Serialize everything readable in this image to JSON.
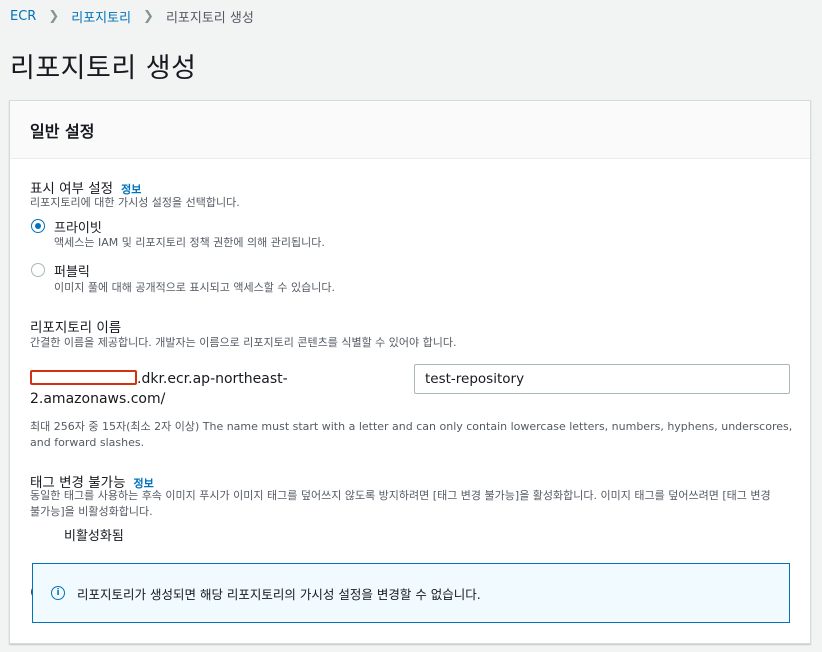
{
  "breadcrumb": {
    "items": [
      "ECR",
      "리포지토리"
    ],
    "current": "리포지토리 생성"
  },
  "page_title": "리포지토리 생성",
  "general": {
    "title": "일반 설정",
    "visibility": {
      "label": "표시 여부 설정",
      "info": "정보",
      "description": "리포지토리에 대한 가시성 설정을 선택합니다.",
      "options": [
        {
          "label": "프라이빗",
          "description": "액세스는 IAM 및 리포지토리 정책 권한에 의해 관리됩니다.",
          "selected": true
        },
        {
          "label": "퍼블릭",
          "description": "이미지 풀에 대해 공개적으로 표시되고 액세스할 수 있습니다.",
          "selected": false
        }
      ]
    },
    "repo_name": {
      "label": "리포지토리 이름",
      "description": "간결한 이름을 제공합니다. 개발자는 이름으로 리포지토리 콘텐츠를 식별할 수 있어야 합니다.",
      "uri_suffix_line1": ".dkr.ecr.ap-northeast-",
      "uri_suffix_line2": "2.amazonaws.com/",
      "value": "test-repository",
      "constraint_line1": "최대 256자 중 15자(최소 2자 이상) The name must start with a letter and can only contain lowercase letters, numbers, hyphens, underscores,",
      "constraint_line2": "and forward slashes."
    },
    "tag_immutability": {
      "label": "태그 변경 불가능",
      "info": "정보",
      "description_line1": "동일한 태그를 사용하는 후속 이미지 푸시가 이미지 태그를 덮어쓰지 않도록 방지하려면 [태그 변경 불가능]을 활성화합니다. 이미지 태그를 덮어쓰려면 [태그 변경",
      "description_line2": "불가능]을 비활성화합니다.",
      "toggle_label": "비활성화됨",
      "enabled": false
    },
    "alert": {
      "icon": "info-icon",
      "text": "리포지토리가 생성되면 해당 리포지토리의 가시성 설정을 변경할 수 없습니다."
    }
  },
  "colors": {
    "link": "#0073bb",
    "redaction": "#d13212",
    "background": "#f2f3f3"
  }
}
